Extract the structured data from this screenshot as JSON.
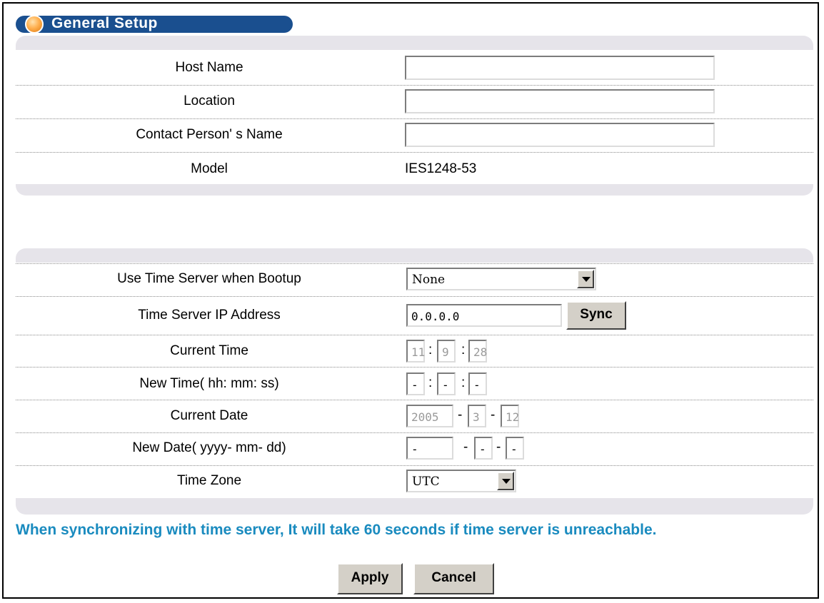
{
  "header": {
    "title": "General Setup"
  },
  "general": {
    "host_name_label": "Host Name",
    "host_name_value": "",
    "location_label": "Location",
    "location_value": "",
    "contact_label": "Contact Person' s Name",
    "contact_value": "",
    "model_label": "Model",
    "model_value": "IES1248-53"
  },
  "time": {
    "boot_label": "Use Time Server when Bootup",
    "boot_value": "None",
    "server_ip_label": "Time Server IP Address",
    "server_ip_value": "0.0.0.0",
    "sync_label": "Sync",
    "current_time_label": "Current Time",
    "current_time": {
      "hh": "11",
      "mm": "9",
      "ss": "28"
    },
    "new_time_label": "New Time( hh: mm: ss)",
    "new_time": {
      "hh": "-",
      "mm": "-",
      "ss": "-"
    },
    "current_date_label": "Current Date",
    "current_date": {
      "yyyy": "2005",
      "mm": "3",
      "dd": "12"
    },
    "new_date_label": "New Date( yyyy- mm- dd)",
    "new_date": {
      "yyyy": "-",
      "mm": "-",
      "dd": "-"
    },
    "tz_label": "Time Zone",
    "tz_value": "UTC",
    "time_sep": ":",
    "date_sep": "-"
  },
  "note": "When synchronizing with time server, It will take 60 seconds if time server is unreachable.",
  "actions": {
    "apply": "Apply",
    "cancel": "Cancel"
  },
  "colors": {
    "title_bg": "#1a4f8f",
    "note": "#1a8bbf",
    "panel": "#e6e4ea"
  }
}
